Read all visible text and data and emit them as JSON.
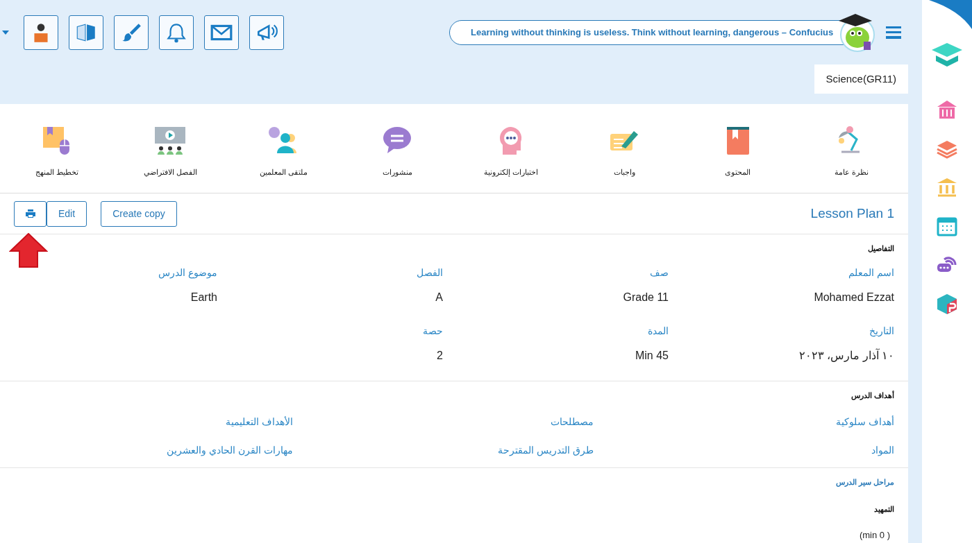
{
  "header": {
    "quote": "Learning without thinking is useless. Think without learning, dangerous – Confucius",
    "subject": "Science(GR11)"
  },
  "nav": [
    {
      "label": "نظرة عامة"
    },
    {
      "label": "المحتوى"
    },
    {
      "label": "واجبات"
    },
    {
      "label": "اختبارات إلكترونية"
    },
    {
      "label": "منشورات"
    },
    {
      "label": "ملتقى المعلمين"
    },
    {
      "label": "الفصل الافتراضي"
    },
    {
      "label": "تخطيط المنهج"
    }
  ],
  "lesson": {
    "title": "Lesson Plan 1",
    "actions": [
      "Create copy",
      "Edit"
    ]
  },
  "details": {
    "heading": "التفاصيل",
    "fields": [
      {
        "label": "اسم المعلم",
        "value": "Mohamed Ezzat"
      },
      {
        "label": "صف",
        "value": "Grade 11"
      },
      {
        "label": "الفصل",
        "value": "A"
      },
      {
        "label": "موضوع الدرس",
        "value": "Earth"
      },
      {
        "label": "التاريخ",
        "value": "١٠ آذار مارس، ٢٠٢٣"
      },
      {
        "label": "المدة",
        "value": "Min 45"
      },
      {
        "label": "حصة",
        "value": "2"
      }
    ]
  },
  "objectives": {
    "heading": "أهداف الدرس",
    "links": [
      "أهداف سلوكية",
      "مصطلحات",
      "الأهداف التعليمية",
      "المواد",
      "طرق التدريس المقترحة",
      "مهارات القرن الحادي والعشرين"
    ]
  },
  "stages": {
    "heading": "مراحل سير الدرس",
    "items": [
      {
        "title": "التمهيد",
        "duration": "(min 0 )"
      }
    ]
  }
}
